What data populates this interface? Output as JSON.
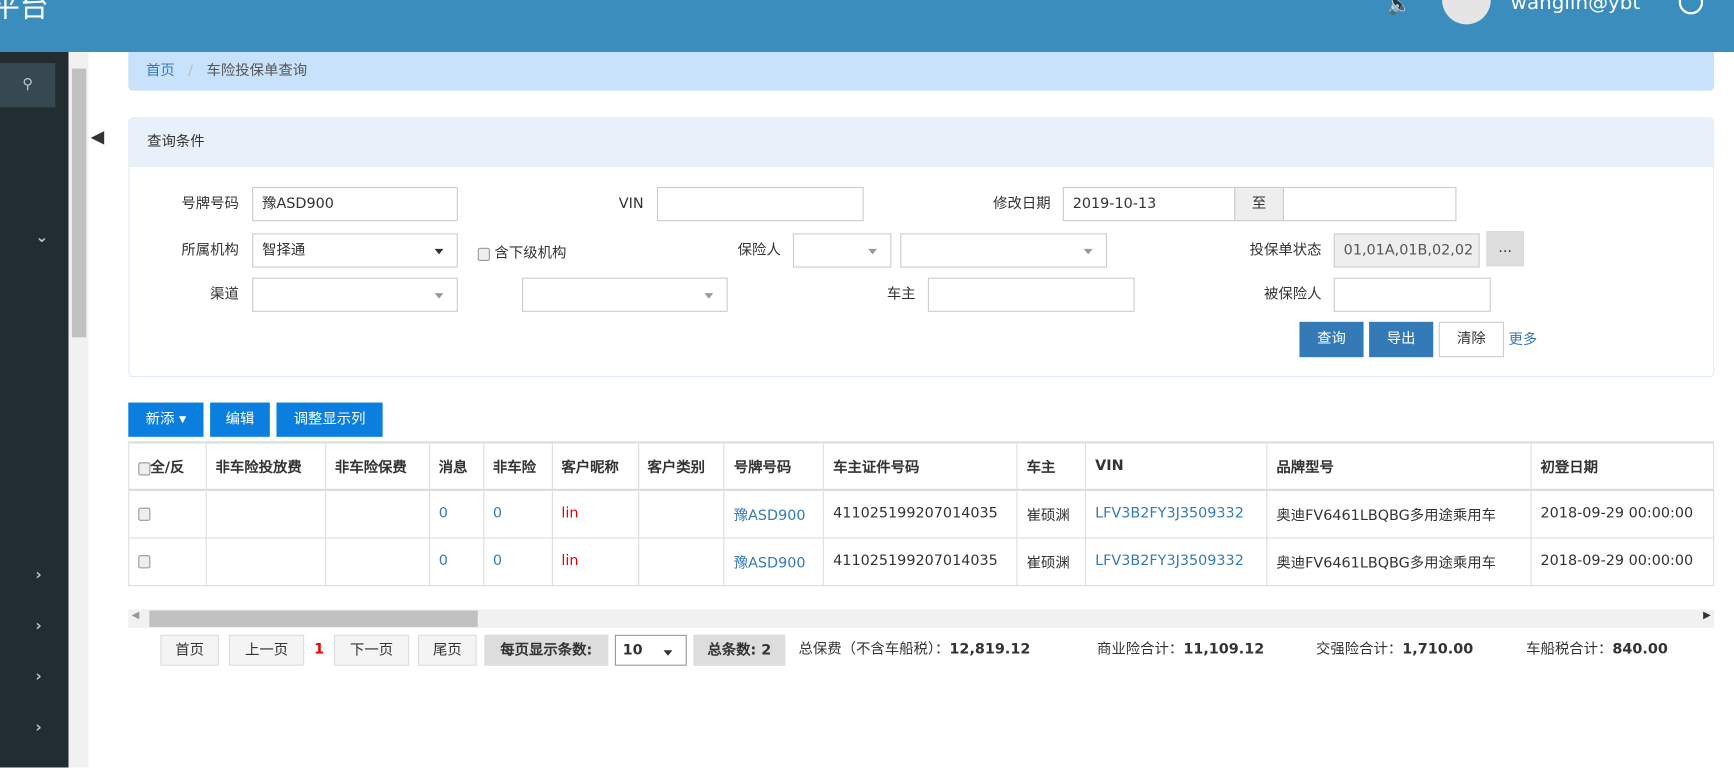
{
  "header": {
    "title": "平台",
    "username": "wanglin@ybt",
    "brand_color": "#3a8dbd"
  },
  "breadcrumb": {
    "home": "首页",
    "separator": "/",
    "current": "车险投保单查询"
  },
  "query": {
    "title": "查询条件",
    "plate_label": "号牌号码",
    "plate_value": "豫ASD900",
    "vin_label": "VIN",
    "vin_value": "",
    "modify_date_label": "修改日期",
    "date_from": "2019-10-13",
    "date_to_label": "至",
    "date_to": "",
    "org_label": "所属机构",
    "org_value": "智择通",
    "include_sub_label": "含下级机构",
    "insurer_label": "保险人",
    "status_label": "投保单状态",
    "status_value": "01,01A,01B,02,02",
    "status_more": "...",
    "channel_label": "渠道",
    "owner_label": "车主",
    "owner_value": "",
    "insured_label": "被保险人",
    "insured_value": "",
    "search": "查询",
    "export": "导出",
    "clear": "清除",
    "more": "更多"
  },
  "toolbar": {
    "add": "新添",
    "edit": "编辑",
    "columns": "调整显示列"
  },
  "table": {
    "headers": [
      "全/反",
      "非车险投放费",
      "非车险保费",
      "消息",
      "非车险",
      "客户昵称",
      "客户类别",
      "号牌号码",
      "车主证件号码",
      "车主",
      "VIN",
      "品牌型号",
      "初登日期"
    ],
    "rows": [
      [
        "",
        "",
        "",
        "0",
        "0",
        "lin",
        "",
        "豫ASD900",
        "411025199207014035",
        "崔硕渊",
        "LFV3B2FY3J3509332",
        "奥迪FV6461LBQBG多用途乘用车",
        "2018-09-29 00:00:00"
      ],
      [
        "",
        "",
        "",
        "0",
        "0",
        "lin",
        "",
        "豫ASD900",
        "411025199207014035",
        "崔硕渊",
        "LFV3B2FY3J3509332",
        "奥迪FV6461LBQBG多用途乘用车",
        "2018-09-29 00:00:00"
      ]
    ]
  },
  "pagination": {
    "first": "首页",
    "prev": "上一页",
    "current": "1",
    "next": "下一页",
    "last": "尾页",
    "page_size_label": "每页显示条数:",
    "page_size": "10",
    "total_label": "总条数: 2",
    "total_premium_label": "总保费（不含车船税）：",
    "total_premium": "12,819.12",
    "commercial_label": "商业险合计：",
    "commercial": "11,109.12",
    "compulsory_label": "交强险合计：",
    "compulsory": "1,710.00",
    "tax_label": "车船税合计：",
    "tax": "840.00"
  }
}
